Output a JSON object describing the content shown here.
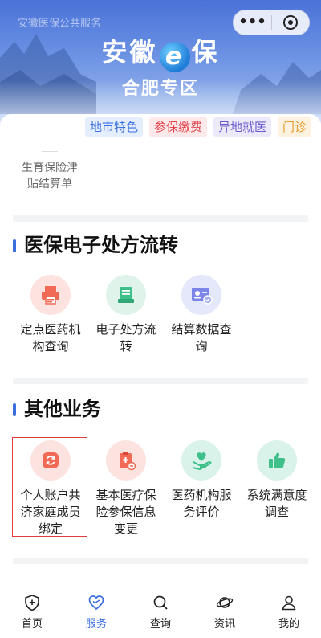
{
  "header": {
    "service_label": "安徽医保公共服务",
    "brand_left": "安徽",
    "brand_e": "e",
    "brand_right": "保",
    "zone": "合肥专区"
  },
  "capsule": {
    "more_icon": "ellipsis-icon",
    "close_icon": "target-icon"
  },
  "chips": [
    "地市特色",
    "参保缴费",
    "异地就医",
    "门诊"
  ],
  "partial_item": {
    "label_line1": "生育保险津",
    "label_line2": "贴结算单"
  },
  "sections": [
    {
      "title": "医保电子处方流转",
      "items": [
        {
          "line1": "定点医药机",
          "line2": "构查询",
          "line3": "",
          "icon": "printer-icon",
          "bg": "#fde3e0"
        },
        {
          "line1": "电子处方流",
          "line2": "转",
          "line3": "",
          "icon": "prescription-icon",
          "bg": "#dff3ea"
        },
        {
          "line1": "结算数据查",
          "line2": "询",
          "line3": "",
          "icon": "id-card-icon",
          "bg": "#e5e7fb"
        }
      ]
    },
    {
      "title": "其他业务",
      "items": [
        {
          "line1": "个人账户共",
          "line2": "济家庭成员",
          "line3": "绑定",
          "icon": "sync-icon",
          "bg": "#fde3e0"
        },
        {
          "line1": "基本医疗保",
          "line2": "险参保信息",
          "line3": "变更",
          "icon": "clipboard-icon",
          "bg": "#fde3e0"
        },
        {
          "line1": "医药机构服",
          "line2": "务评价",
          "line3": "",
          "icon": "heart-hand-icon",
          "bg": "#d9f2ea"
        },
        {
          "line1": "系统满意度",
          "line2": "调查",
          "line3": "",
          "icon": "thumbs-up-icon",
          "bg": "#d9f2ea"
        }
      ]
    }
  ],
  "tabs": [
    {
      "label": "首页",
      "icon": "shield-plus-icon"
    },
    {
      "label": "服务",
      "icon": "heart-icon"
    },
    {
      "label": "查询",
      "icon": "search-icon"
    },
    {
      "label": "资讯",
      "icon": "planet-icon"
    },
    {
      "label": "我的",
      "icon": "user-icon"
    }
  ],
  "colors": {
    "accent": "#3b6fe0",
    "highlight": "#e33a3a",
    "icon_red": "#f06a55",
    "icon_green": "#3fbf8a",
    "icon_lav": "#7b86e8"
  }
}
